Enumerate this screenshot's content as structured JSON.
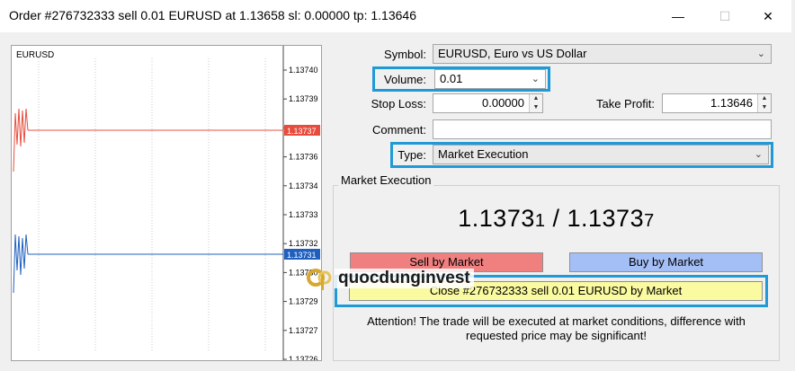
{
  "window": {
    "title": "Order #276732333 sell 0.01 EURUSD at 1.13658 sl: 0.00000 tp: 1.13646",
    "minimize_glyph": "—",
    "maximize_glyph": "☐",
    "close_glyph": "✕"
  },
  "chart": {
    "symbol": "EURUSD",
    "axis_labels": [
      "1.13740",
      "1.13739",
      "1.13737",
      "1.13736",
      "1.13734",
      "1.13733",
      "1.13732",
      "1.13730",
      "1.13729",
      "1.13727",
      "1.13726"
    ],
    "ask_tag": "1.13737",
    "bid_tag": "1.13731",
    "ask_color": "#e74c3c",
    "bid_color": "#1f5fbf"
  },
  "form": {
    "symbol_label": "Symbol:",
    "symbol_value": "EURUSD, Euro vs US Dollar",
    "volume_label": "Volume:",
    "volume_value": "0.01",
    "stop_loss_label": "Stop Loss:",
    "stop_loss_value": "0.00000",
    "take_profit_label": "Take Profit:",
    "take_profit_value": "1.13646",
    "comment_label": "Comment:",
    "comment_value": "",
    "type_label": "Type:",
    "type_value": "Market Execution"
  },
  "market": {
    "group_label": "Market Execution",
    "bid_main": "1.1373",
    "bid_last": "1",
    "separator": " / ",
    "ask_main": "1.1373",
    "ask_last": "7",
    "sell_label": "Sell by Market",
    "buy_label": "Buy by Market",
    "close_label": "Close #276732333 sell 0.01 EURUSD by Market",
    "attention_line1": "Attention! The trade will be executed at market conditions, difference with",
    "attention_line2": "requested price may be significant!"
  },
  "watermark": {
    "text": "quocdunginvest"
  },
  "colors": {
    "highlight": "#1f9ad6",
    "sell_button": "#f08080",
    "buy_button": "#a4bff5",
    "close_button": "#fafaa0"
  }
}
